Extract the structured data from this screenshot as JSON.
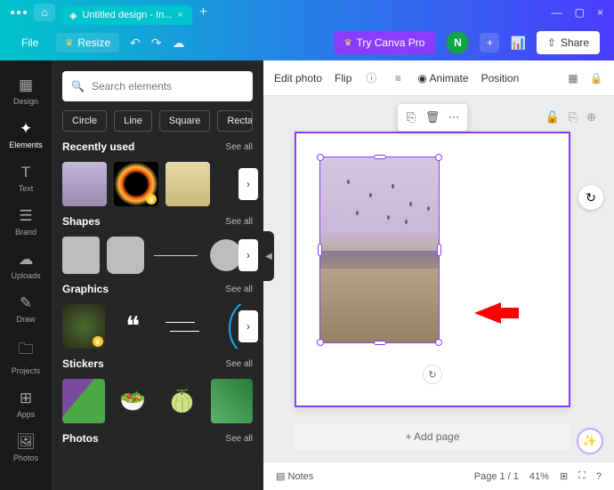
{
  "titlebar": {
    "tab_title": "Untitled design - In...",
    "tab_close": "×",
    "new_tab": "+",
    "min": "—",
    "max": "▢",
    "close": "×"
  },
  "toolbar": {
    "file": "File",
    "resize": "Resize",
    "try_pro": "Try Canva Pro",
    "avatar_initial": "N",
    "share": "Share"
  },
  "sidenav": {
    "design": "Design",
    "elements": "Elements",
    "text": "Text",
    "brand": "Brand",
    "uploads": "Uploads",
    "draw": "Draw",
    "projects": "Projects",
    "apps": "Apps",
    "photos": "Photos"
  },
  "panel": {
    "search_placeholder": "Search elements",
    "chips": {
      "circle": "Circle",
      "line": "Line",
      "square": "Square",
      "rect": "Rectang"
    },
    "sec1": "Recently used",
    "sec2": "Shapes",
    "sec3": "Graphics",
    "sec4": "Stickers",
    "sec5": "Photos",
    "seeall": "See all"
  },
  "context_bar": {
    "edit_photo": "Edit photo",
    "flip": "Flip",
    "animate": "Animate",
    "position": "Position"
  },
  "canvas": {
    "rotate": "↻",
    "add_page": "+ Add page"
  },
  "footer": {
    "notes": "Notes",
    "page": "Page 1 / 1",
    "zoom": "41%"
  }
}
